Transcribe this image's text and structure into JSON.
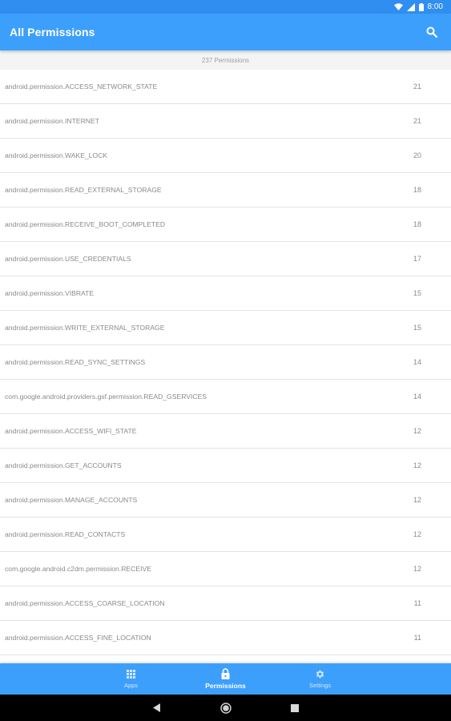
{
  "status_bar": {
    "time": "8:00",
    "icons": [
      "wifi-icon",
      "signal-icon",
      "battery-icon"
    ]
  },
  "app_bar": {
    "title": "All Permissions",
    "search_icon": "search-icon"
  },
  "list_header": {
    "count_text": "237 Permissions"
  },
  "permissions": [
    {
      "name": "android.permission.ACCESS_NETWORK_STATE",
      "count": "21"
    },
    {
      "name": "android.permission.INTERNET",
      "count": "21"
    },
    {
      "name": "android.permission.WAKE_LOCK",
      "count": "20"
    },
    {
      "name": "android.permission.READ_EXTERNAL_STORAGE",
      "count": "18"
    },
    {
      "name": "android.permission.RECEIVE_BOOT_COMPLETED",
      "count": "18"
    },
    {
      "name": "android.permission.USE_CREDENTIALS",
      "count": "17"
    },
    {
      "name": "android.permission.VIBRATE",
      "count": "15"
    },
    {
      "name": "android.permission.WRITE_EXTERNAL_STORAGE",
      "count": "15"
    },
    {
      "name": "android.permission.READ_SYNC_SETTINGS",
      "count": "14"
    },
    {
      "name": "com.google.android.providers.gsf.permission.READ_GSERVICES",
      "count": "14"
    },
    {
      "name": "android.permission.ACCESS_WIFI_STATE",
      "count": "12"
    },
    {
      "name": "android.permission.GET_ACCOUNTS",
      "count": "12"
    },
    {
      "name": "android.permission.MANAGE_ACCOUNTS",
      "count": "12"
    },
    {
      "name": "android.permission.READ_CONTACTS",
      "count": "12"
    },
    {
      "name": "com.google.android.c2dm.permission.RECEIVE",
      "count": "12"
    },
    {
      "name": "android.permission.ACCESS_COARSE_LOCATION",
      "count": "11"
    },
    {
      "name": "android.permission.ACCESS_FINE_LOCATION",
      "count": "11"
    },
    {
      "name": "",
      "count": ""
    }
  ],
  "bottom_nav": {
    "items": [
      {
        "label": "Apps",
        "icon": "grid-icon",
        "active": false
      },
      {
        "label": "Permissions",
        "icon": "lock-icon",
        "active": true
      },
      {
        "label": "Settings",
        "icon": "gear-icon",
        "active": false
      }
    ]
  },
  "system_nav": {
    "buttons": [
      "back-icon",
      "home-icon",
      "recents-icon"
    ]
  },
  "colors": {
    "primary": "#3d9ffc",
    "status_bar": "#2f8ef0",
    "text_secondary": "#8a8a8a",
    "divider": "#e3e3e3"
  }
}
